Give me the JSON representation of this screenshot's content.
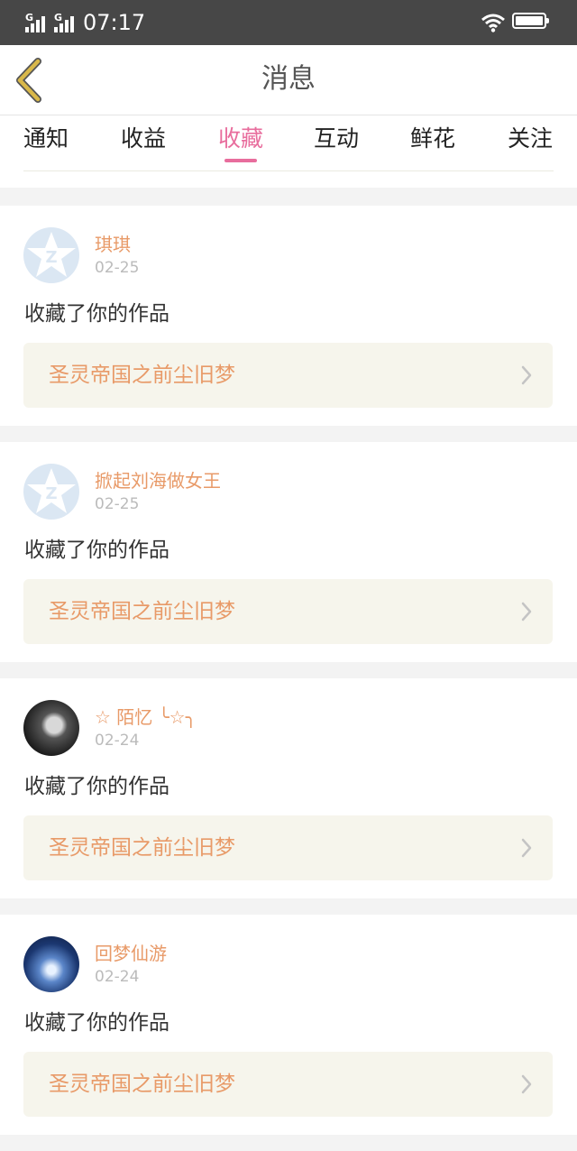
{
  "status_bar": {
    "time": "07:17",
    "signal_label_1": "G",
    "signal_label_2": "G",
    "icons": [
      "signal-icon",
      "signal-icon",
      "wifi-icon",
      "battery-icon"
    ]
  },
  "header": {
    "title": "消息",
    "back_icon": "back-chevron-icon"
  },
  "tabs": [
    {
      "label": "通知",
      "active": false
    },
    {
      "label": "收益",
      "active": false
    },
    {
      "label": "收藏",
      "active": true
    },
    {
      "label": "互动",
      "active": false
    },
    {
      "label": "鲜花",
      "active": false
    },
    {
      "label": "关注",
      "active": false
    }
  ],
  "messages": [
    {
      "username": "琪琪",
      "date": "02-25",
      "action": "收藏了你的作品",
      "work_title": "圣灵帝国之前尘旧梦",
      "avatar": "default-avatar-icon"
    },
    {
      "username": "掀起刘海做女王",
      "date": "02-25",
      "action": "收藏了你的作品",
      "work_title": "圣灵帝国之前尘旧梦",
      "avatar": "default-avatar-icon"
    },
    {
      "username": "☆ 陌忆 ╰☆╮",
      "date": "02-24",
      "action": "收藏了你的作品",
      "work_title": "圣灵帝国之前尘旧梦",
      "avatar": "photo-avatar"
    },
    {
      "username": "回梦仙游",
      "date": "02-24",
      "action": "收藏了你的作品",
      "work_title": "圣灵帝国之前尘旧梦",
      "avatar": "photo-avatar"
    }
  ],
  "colors": {
    "accent": "#e86d9d",
    "username": "#e89a68",
    "back_icon": "#d9b84a",
    "status_bar": "#474747"
  }
}
